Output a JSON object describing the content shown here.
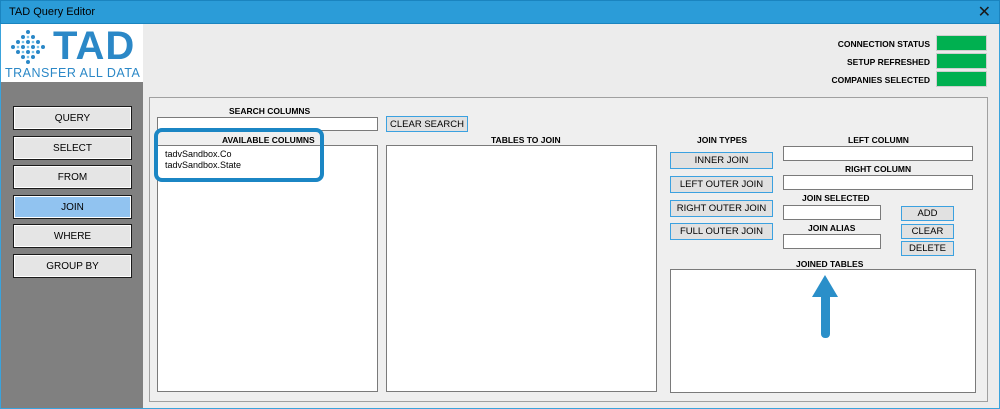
{
  "window": {
    "title": "TAD Query Editor",
    "close_glyph": "✕"
  },
  "logo": {
    "brand": "TAD",
    "tagline": "TRANSFER ALL DATA"
  },
  "nav": [
    {
      "label": "QUERY",
      "active": false
    },
    {
      "label": "SELECT",
      "active": false
    },
    {
      "label": "FROM",
      "active": false
    },
    {
      "label": "JOIN",
      "active": true
    },
    {
      "label": "WHERE",
      "active": false
    },
    {
      "label": "GROUP BY",
      "active": false
    }
  ],
  "status": {
    "connection": "CONNECTION STATUS",
    "setup": "SETUP REFRESHED",
    "companies": "COMPANIES SELECTED",
    "indicator_color": "#00b050"
  },
  "search": {
    "label": "SEARCH COLUMNS",
    "value": "",
    "clear_label": "CLEAR SEARCH"
  },
  "available_columns": {
    "label": "AVAILABLE COLUMNS",
    "items": [
      "tadvSandbox.Co",
      "tadvSandbox.State"
    ]
  },
  "tables_to_join": {
    "label": "TABLES TO JOIN"
  },
  "join_types": {
    "label": "JOIN TYPES",
    "inner": "INNER JOIN",
    "left_outer": "LEFT OUTER JOIN",
    "right_outer": "RIGHT OUTER JOIN",
    "full_outer": "FULL OUTER JOIN"
  },
  "left_column": {
    "label": "LEFT COLUMN",
    "value": ""
  },
  "right_column": {
    "label": "RIGHT COLUMN",
    "value": ""
  },
  "join_selected": {
    "label": "JOIN SELECTED",
    "value": ""
  },
  "join_alias": {
    "label": "JOIN ALIAS",
    "value": ""
  },
  "actions": {
    "add": "ADD",
    "clear": "CLEAR",
    "delete": "DELETE"
  },
  "joined_tables": {
    "label": "JOINED TABLES"
  },
  "annotation_color": "#1b86c4"
}
